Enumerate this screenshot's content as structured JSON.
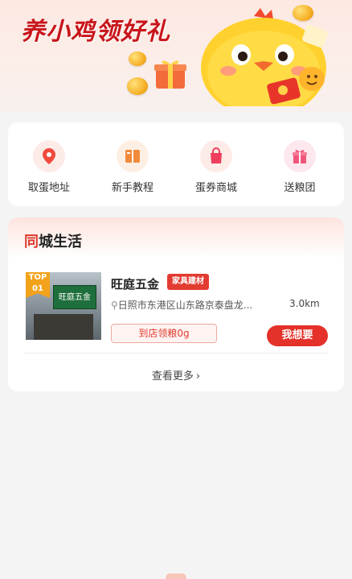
{
  "banner": {
    "title": "养小鸡领好礼"
  },
  "menu": {
    "items": [
      {
        "label": "取蛋地址",
        "icon": "location-pin-icon"
      },
      {
        "label": "新手教程",
        "icon": "book-icon"
      },
      {
        "label": "蛋券商城",
        "icon": "shopping-bag-icon"
      },
      {
        "label": "送粮团",
        "icon": "gift-icon"
      }
    ]
  },
  "life": {
    "title_accent": "同",
    "title_rest": "城生活",
    "stores": [
      {
        "rank_top": "TOP",
        "rank_num": "01",
        "sign_text": "旺庭五金",
        "name": "旺庭五金",
        "tag": "家具建材",
        "address": "日照市东港区山东路京泰盘龙...",
        "distance": "3.0km",
        "coupon": "到店领粮0g",
        "action": "我想要"
      }
    ],
    "more_label": "查看更多"
  },
  "colors": {
    "accent": "#e4312a",
    "title_red": "#c8151b",
    "badge_orange": "#f3a21b"
  }
}
